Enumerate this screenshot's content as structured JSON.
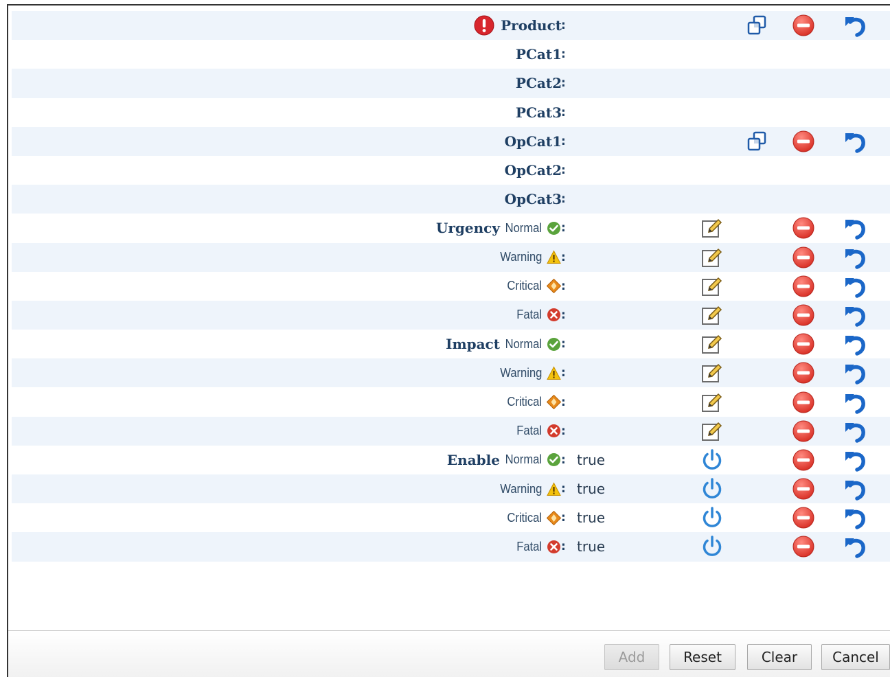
{
  "rows": [
    {
      "group": "Product",
      "sub": "",
      "severity": "",
      "value": "",
      "actions": [
        "copy",
        "remove",
        "undo"
      ],
      "error": true
    },
    {
      "group": "PCat1",
      "sub": "",
      "severity": "",
      "value": "",
      "actions": []
    },
    {
      "group": "PCat2",
      "sub": "",
      "severity": "",
      "value": "",
      "actions": []
    },
    {
      "group": "PCat3",
      "sub": "",
      "severity": "",
      "value": "",
      "actions": []
    },
    {
      "group": "OpCat1",
      "sub": "",
      "severity": "",
      "value": "",
      "actions": [
        "copy",
        "remove",
        "undo"
      ]
    },
    {
      "group": "OpCat2",
      "sub": "",
      "severity": "",
      "value": "",
      "actions": []
    },
    {
      "group": "OpCat3",
      "sub": "",
      "severity": "",
      "value": "",
      "actions": []
    },
    {
      "group": "Urgency",
      "sub": "Normal",
      "severity": "normal",
      "value": "",
      "actions": [
        "edit",
        "remove",
        "undo"
      ]
    },
    {
      "group": "",
      "sub": "Warning",
      "severity": "warning",
      "value": "",
      "actions": [
        "edit",
        "remove",
        "undo"
      ]
    },
    {
      "group": "",
      "sub": "Critical",
      "severity": "critical",
      "value": "",
      "actions": [
        "edit",
        "remove",
        "undo"
      ]
    },
    {
      "group": "",
      "sub": "Fatal",
      "severity": "fatal",
      "value": "",
      "actions": [
        "edit",
        "remove",
        "undo"
      ]
    },
    {
      "group": "Impact",
      "sub": "Normal",
      "severity": "normal",
      "value": "",
      "actions": [
        "edit",
        "remove",
        "undo"
      ]
    },
    {
      "group": "",
      "sub": "Warning",
      "severity": "warning",
      "value": "",
      "actions": [
        "edit",
        "remove",
        "undo"
      ]
    },
    {
      "group": "",
      "sub": "Critical",
      "severity": "critical",
      "value": "",
      "actions": [
        "edit",
        "remove",
        "undo"
      ]
    },
    {
      "group": "",
      "sub": "Fatal",
      "severity": "fatal",
      "value": "",
      "actions": [
        "edit",
        "remove",
        "undo"
      ]
    },
    {
      "group": "Enable",
      "sub": "Normal",
      "severity": "normal",
      "value": "true",
      "actions": [
        "power",
        "remove",
        "undo"
      ]
    },
    {
      "group": "",
      "sub": "Warning",
      "severity": "warning",
      "value": "true",
      "actions": [
        "power",
        "remove",
        "undo"
      ]
    },
    {
      "group": "",
      "sub": "Critical",
      "severity": "critical",
      "value": "true",
      "actions": [
        "power",
        "remove",
        "undo"
      ]
    },
    {
      "group": "",
      "sub": "Fatal",
      "severity": "fatal",
      "value": "true",
      "actions": [
        "power",
        "remove",
        "undo"
      ]
    }
  ],
  "colon": ":",
  "buttons": {
    "add": {
      "label": "Add",
      "disabled": true
    },
    "reset": {
      "label": "Reset"
    },
    "clear": {
      "label": "Clear"
    },
    "cancel": {
      "label": "Cancel"
    }
  },
  "colors": {
    "row_stripe": "#eef4fb",
    "label_text": "#1f3f63",
    "remove_red": "#e03a33",
    "undo_blue": "#1b67c8",
    "power_blue": "#2f86d6",
    "normal_green": "#5aa33c",
    "warning_yellow": "#f4c20d",
    "critical_orange": "#e88a1a",
    "fatal_red": "#d33b2c"
  }
}
